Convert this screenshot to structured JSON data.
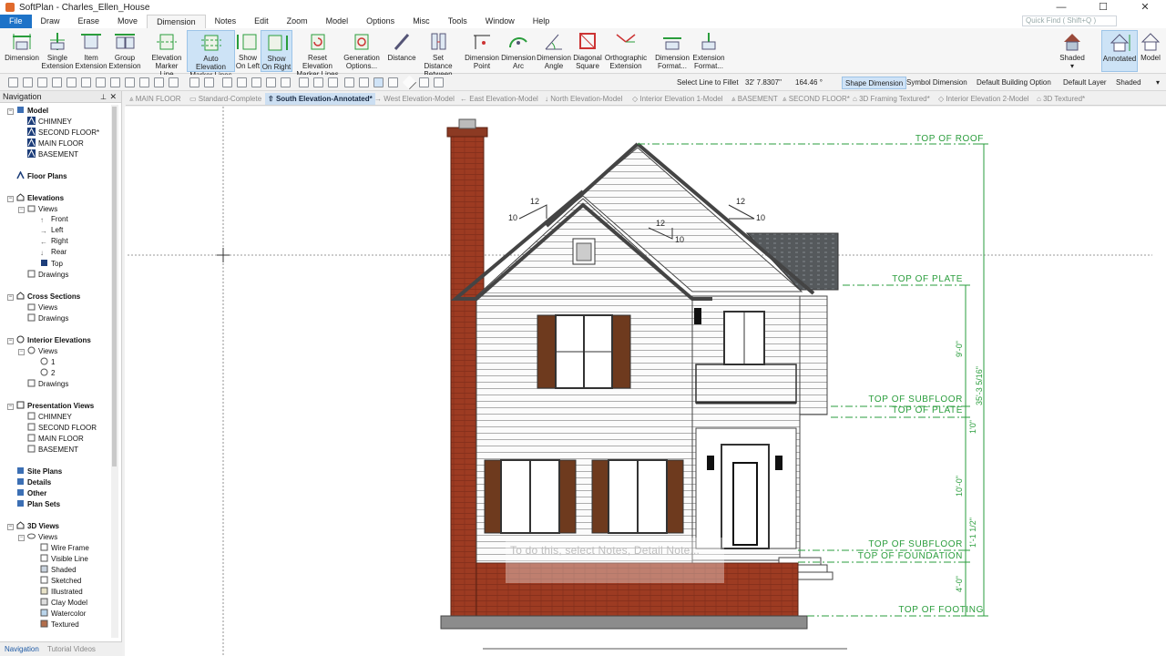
{
  "window": {
    "title": "SoftPlan - Charles_Ellen_House",
    "controls": [
      "—",
      "☐",
      "✕"
    ]
  },
  "menu": {
    "items": [
      "File",
      "Draw",
      "Erase",
      "Move",
      "Dimension",
      "Notes",
      "Edit",
      "Zoom",
      "Model",
      "Options",
      "Misc",
      "Tools",
      "Window",
      "Help"
    ],
    "active": "Dimension",
    "quick_find": "Quick Find ( Shift+Q )"
  },
  "ribbon": {
    "buttons": [
      {
        "line1": "Dimension",
        "line2": ""
      },
      {
        "line1": "Single",
        "line2": "Extension"
      },
      {
        "line1": "Item",
        "line2": "Extension"
      },
      {
        "line1": "Group",
        "line2": "Extension"
      },
      {
        "line1": "Elevation",
        "line2": "Marker Line"
      },
      {
        "line1": "Auto Elevation",
        "line2": "Marker Lines"
      },
      {
        "line1": "Show",
        "line2": "On Left"
      },
      {
        "line1": "Show",
        "line2": "On Right"
      },
      {
        "line1": "Reset Elevation",
        "line2": "Marker Lines"
      },
      {
        "line1": "Generation",
        "line2": "Options..."
      },
      {
        "line1": "Distance",
        "line2": ""
      },
      {
        "line1": "Set Distance",
        "line2": "Between"
      },
      {
        "line1": "Dimension",
        "line2": "Point"
      },
      {
        "line1": "Dimension",
        "line2": "Arc"
      },
      {
        "line1": "Dimension",
        "line2": "Angle"
      },
      {
        "line1": "Diagonal",
        "line2": "Square"
      },
      {
        "line1": "Orthographic",
        "line2": "Extension"
      },
      {
        "line1": "Dimension",
        "line2": "Format..."
      },
      {
        "line1": "Extension",
        "line2": "Format..."
      },
      {
        "line1": "Shaded",
        "line2": ""
      },
      {
        "line1": "Annotated",
        "line2": ""
      },
      {
        "line1": "Model",
        "line2": ""
      }
    ]
  },
  "toolbar": {
    "select_line": "Select Line to Fillet",
    "coord1": "32' 7.8307\"",
    "coord2": "164.46 °",
    "shape_dimension": "Shape Dimension",
    "symbol_dimension": "Symbol Dimension",
    "default_building": "Default Building Option",
    "default_layer": "Default Layer",
    "shaded": "Shaded"
  },
  "tabs": [
    "MAIN FLOOR",
    "Standard-Complete",
    "South Elevation-Annotated*",
    "West Elevation-Model",
    "East Elevation-Model",
    "North Elevation-Model",
    "Interior Elevation 1-Model",
    "BASEMENT",
    "SECOND FLOOR*",
    "3D Framing Textured*",
    "Interior Elevation 2-Model",
    "3D Textured*"
  ],
  "navigation": {
    "header": "Navigation",
    "items": [
      {
        "label": "Model",
        "bold": true
      },
      {
        "label": "CHIMNEY"
      },
      {
        "label": "SECOND FLOOR*"
      },
      {
        "label": "MAIN FLOOR"
      },
      {
        "label": "BASEMENT"
      },
      {
        "label": "Floor Plans",
        "bold": true
      },
      {
        "label": "Elevations",
        "bold": true
      },
      {
        "label": "Views"
      },
      {
        "label": "Front"
      },
      {
        "label": "Left"
      },
      {
        "label": "Right"
      },
      {
        "label": "Rear"
      },
      {
        "label": "Top"
      },
      {
        "label": "Drawings"
      },
      {
        "label": "Cross Sections",
        "bold": true
      },
      {
        "label": "Views"
      },
      {
        "label": "Drawings"
      },
      {
        "label": "Interior Elevations",
        "bold": true
      },
      {
        "label": "Views"
      },
      {
        "label": "1"
      },
      {
        "label": "2"
      },
      {
        "label": "Drawings"
      },
      {
        "label": "Presentation Views",
        "bold": true
      },
      {
        "label": "CHIMNEY"
      },
      {
        "label": "SECOND FLOOR"
      },
      {
        "label": "MAIN FLOOR"
      },
      {
        "label": "BASEMENT"
      },
      {
        "label": "Site Plans",
        "bold": true
      },
      {
        "label": "Details",
        "bold": true
      },
      {
        "label": "Other",
        "bold": true
      },
      {
        "label": "Plan Sets",
        "bold": true
      },
      {
        "label": "3D Views",
        "bold": true
      },
      {
        "label": "Views"
      },
      {
        "label": "Wire Frame"
      },
      {
        "label": "Visible Line"
      },
      {
        "label": "Shaded"
      },
      {
        "label": "Sketched"
      },
      {
        "label": "Illustrated"
      },
      {
        "label": "Clay Model"
      },
      {
        "label": "Watercolor"
      },
      {
        "label": "Textured"
      }
    ],
    "bottom_tabs": [
      "Navigation",
      "Tutorial Videos"
    ]
  },
  "drawing": {
    "labels": {
      "roof": "TOP OF ROOF",
      "plate_upper": "TOP OF PLATE",
      "subfloor_upper": "TOP OF SUBFLOOR",
      "plate_lower": "TOP OF PLATE",
      "subfloor_lower": "TOP OF SUBFLOOR",
      "foundation": "TOP OF FOUNDATION",
      "footing": "TOP OF FOOTING"
    },
    "dims": {
      "d1": "9'-0\"",
      "d2": "1'0\"",
      "d3": "10'-0\"",
      "d4": "1'-1 1/2\"",
      "d5": "4'-0\"",
      "total": "35'-3 5/16\""
    },
    "pitch": {
      "rise": "12",
      "run": "10"
    },
    "caption": "To do this, select Notes, Detail Note..."
  }
}
